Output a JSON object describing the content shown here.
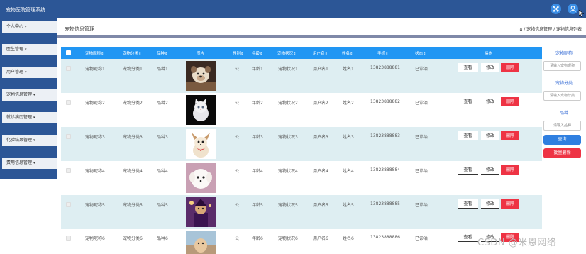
{
  "app": {
    "title": "宠物医院管理系统"
  },
  "topbar": {
    "expand_icon": "expand-arrows-icon",
    "user_icon": "user-icon"
  },
  "sidebar": {
    "items": [
      {
        "label": "个人中心"
      },
      {
        "label": "医生管理"
      },
      {
        "label": "用户管理"
      },
      {
        "label": "宠物信息管理"
      },
      {
        "label": "就诊病历管理"
      },
      {
        "label": "化验结果管理"
      },
      {
        "label": "费用信息管理"
      }
    ]
  },
  "header": {
    "title": "宠物信息管理",
    "breadcrumb": "宠物信息管理 / 宠物信息列表"
  },
  "table": {
    "columns": [
      "宠物昵称",
      "宠物分类",
      "品种",
      "图片",
      "性别",
      "年龄",
      "宠物状况",
      "用户名",
      "姓名",
      "手机",
      "状态",
      "操作"
    ],
    "actions": {
      "view": "查看",
      "edit": "修改",
      "delete": "删除"
    },
    "rows": [
      {
        "nick": "宠物昵称1",
        "category": "宠物分类1",
        "breed": "品种1",
        "gender": "公",
        "age": "年龄1",
        "status_desc": "宠物状况1",
        "username": "用户名1",
        "name": "姓名1",
        "phone": "13823888881",
        "state": "已诊治",
        "photo": "dog-bulldog"
      },
      {
        "nick": "宠物昵称2",
        "category": "宠物分类2",
        "breed": "品种2",
        "gender": "公",
        "age": "年龄2",
        "status_desc": "宠物状况2",
        "username": "用户名2",
        "name": "姓名2",
        "phone": "13823888882",
        "state": "已诊治",
        "photo": "white-kitten"
      },
      {
        "nick": "宠物昵称3",
        "category": "宠物分类3",
        "breed": "品种3",
        "gender": "公",
        "age": "年龄3",
        "status_desc": "宠物状况3",
        "username": "用户名3",
        "name": "姓名3",
        "phone": "13823888883",
        "state": "已诊治",
        "photo": "small-dog-bow"
      },
      {
        "nick": "宠物昵称4",
        "category": "宠物分类4",
        "breed": "品种4",
        "gender": "公",
        "age": "年龄4",
        "status_desc": "宠物状况4",
        "username": "用户名4",
        "name": "姓名4",
        "phone": "13823888884",
        "state": "已诊治",
        "photo": "white-puppy"
      },
      {
        "nick": "宠物昵称5",
        "category": "宠物分类5",
        "breed": "品种5",
        "gender": "公",
        "age": "年龄5",
        "status_desc": "宠物状况5",
        "username": "用户名5",
        "name": "姓名5",
        "phone": "13823888885",
        "state": "已诊治",
        "photo": "costumed-dog"
      },
      {
        "nick": "宠物昵称6",
        "category": "宠物分类6",
        "breed": "品种6",
        "gender": "公",
        "age": "年龄6",
        "status_desc": "宠物状况6",
        "username": "用户名6",
        "name": "姓名6",
        "phone": "13823888886",
        "state": "已诊治",
        "photo": "dog-outdoor"
      }
    ]
  },
  "filters": {
    "nick_label": "宠物昵称",
    "nick_placeholder": "请输入宠物昵称",
    "category_label": "宠物分类",
    "category_placeholder": "请输入宠物分类",
    "breed_label": "品种",
    "breed_placeholder": "请输入品种",
    "search_label": "查询",
    "batch_delete_label": "批量删除"
  },
  "watermark": "CSDN @米恩网络",
  "colors": {
    "topbar": "#2c5696",
    "table_header": "#2196f3",
    "row_alt": "#deeef2",
    "delete": "#ee3344",
    "search": "#2f7fe0"
  }
}
